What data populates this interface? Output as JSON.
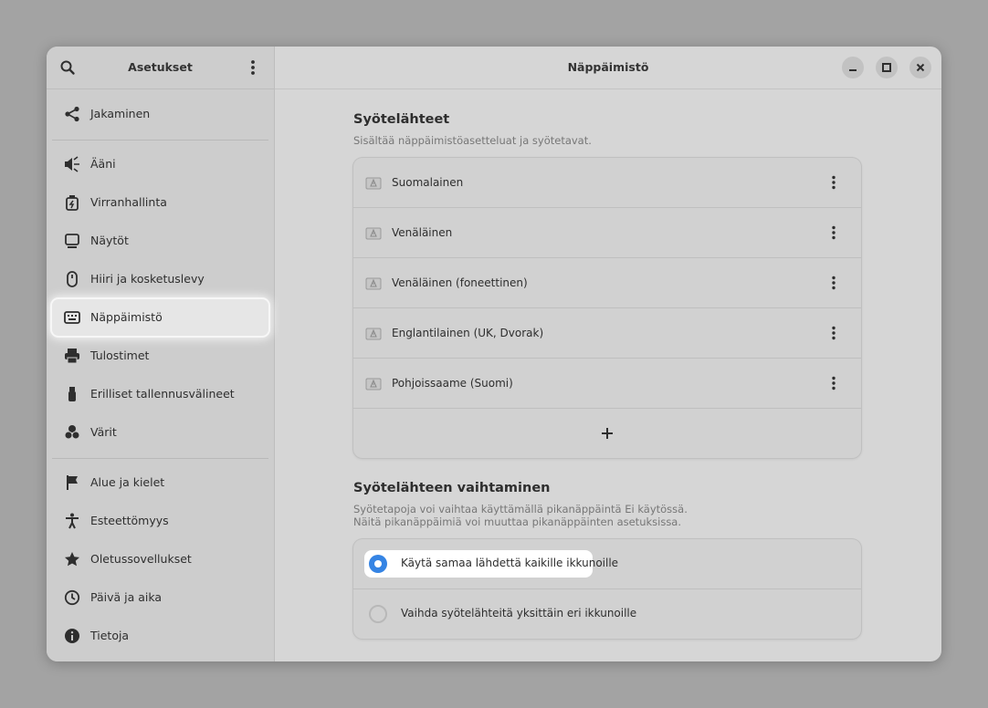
{
  "sidebar": {
    "title": "Asetukset",
    "search_icon": "search-icon",
    "menu_icon": "more-vertical-icon",
    "items": [
      {
        "label": "Jakaminen",
        "icon": "share-icon"
      },
      {
        "label": "Ääni",
        "icon": "speaker-icon"
      },
      {
        "label": "Virranhallinta",
        "icon": "battery-icon"
      },
      {
        "label": "Näytöt",
        "icon": "display-icon"
      },
      {
        "label": "Hiiri ja kosketuslevy",
        "icon": "mouse-icon"
      },
      {
        "label": "Näppäimistö",
        "icon": "keyboard-icon",
        "selected": true
      },
      {
        "label": "Tulostimet",
        "icon": "printer-icon"
      },
      {
        "label": "Erilliset tallennusvälineet",
        "icon": "usb-drive-icon"
      },
      {
        "label": "Värit",
        "icon": "color-icon"
      },
      {
        "label": "Alue ja kielet",
        "icon": "flag-icon"
      },
      {
        "label": "Esteettömyys",
        "icon": "accessibility-icon"
      },
      {
        "label": "Oletussovellukset",
        "icon": "star-icon"
      },
      {
        "label": "Päivä ja aika",
        "icon": "clock-icon"
      },
      {
        "label": "Tietoja",
        "icon": "info-icon"
      }
    ]
  },
  "main": {
    "title": "Näppäimistö",
    "input_sources": {
      "title": "Syötelähteet",
      "subtitle": "Sisältää näppäimistöasetteluat ja syötetavat.",
      "items": [
        {
          "label": "Suomalainen"
        },
        {
          "label": "Venäläinen"
        },
        {
          "label": "Venäläinen (foneettinen)"
        },
        {
          "label": "Englantilainen (UK, Dvorak)"
        },
        {
          "label": "Pohjoissaame (Suomi)"
        }
      ],
      "add_label": "+"
    },
    "switching": {
      "title": "Syötelähteen vaihtaminen",
      "subtitle_line1": "Syötetapoja voi vaihtaa käyttämällä pikanäppäintä Ei käytössä.",
      "subtitle_line2": "Näitä pikanäppäimiä voi muuttaa pikanäppäinten asetuksissa.",
      "options": [
        {
          "label": "Käytä samaa lähdettä kaikille ikkunoille",
          "selected": true
        },
        {
          "label": "Vaihda syötelähteitä yksittäin eri ikkunoille",
          "selected": false
        }
      ]
    }
  },
  "accent_color": "#3584e4"
}
